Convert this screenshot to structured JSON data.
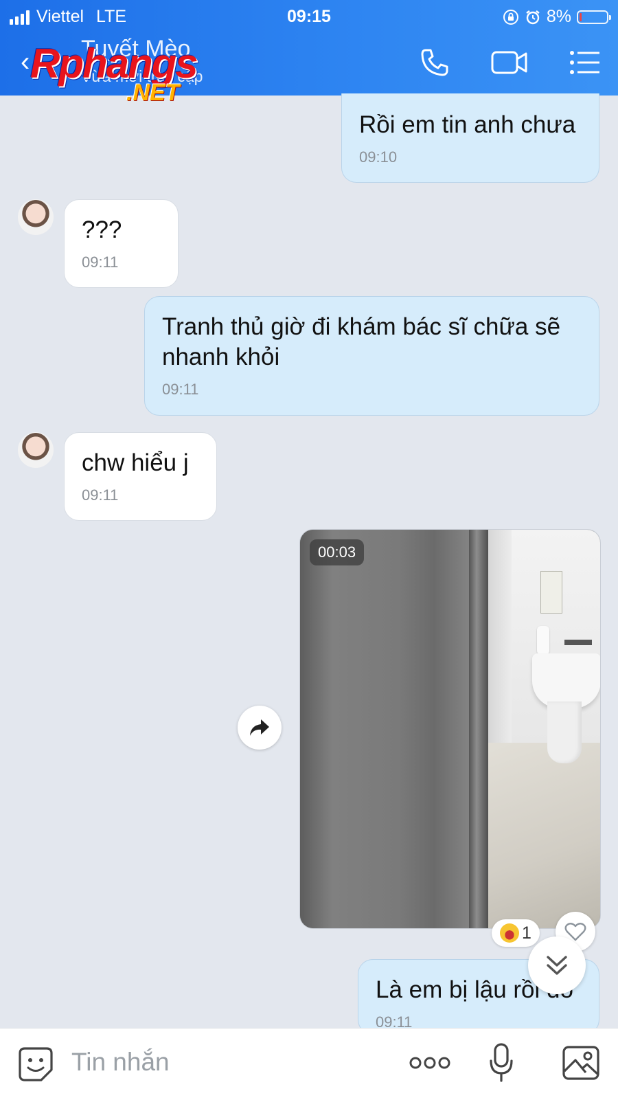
{
  "status_bar": {
    "carrier": "Viettel",
    "network": "LTE",
    "time": "09:15",
    "battery": "8%"
  },
  "header": {
    "contact_name": "Tuyết Mèo",
    "contact_status": "Vừa mới truy cập"
  },
  "watermark": {
    "main": "Rphangs",
    "sub": ".NET"
  },
  "messages": [
    {
      "text": "Rồi em tin anh chưa",
      "time": "09:10"
    },
    {
      "text": "???",
      "time": "09:11"
    },
    {
      "text": "Tranh thủ giờ đi khám bác sĩ chữa sẽ nhanh khỏi",
      "time": "09:11"
    },
    {
      "text": "chw hiểu j",
      "time": "09:11"
    },
    {
      "text": "Là em bị lậu rồi đó",
      "time": "09:11"
    }
  ],
  "video": {
    "duration": "00:03",
    "reaction_count": "1"
  },
  "input": {
    "placeholder": "Tin nhắn"
  },
  "colors": {
    "header": "#2f86f2",
    "outgoing_bubble": "#d6ecfb",
    "incoming_bubble": "#ffffff",
    "background": "#e3e7ee"
  }
}
